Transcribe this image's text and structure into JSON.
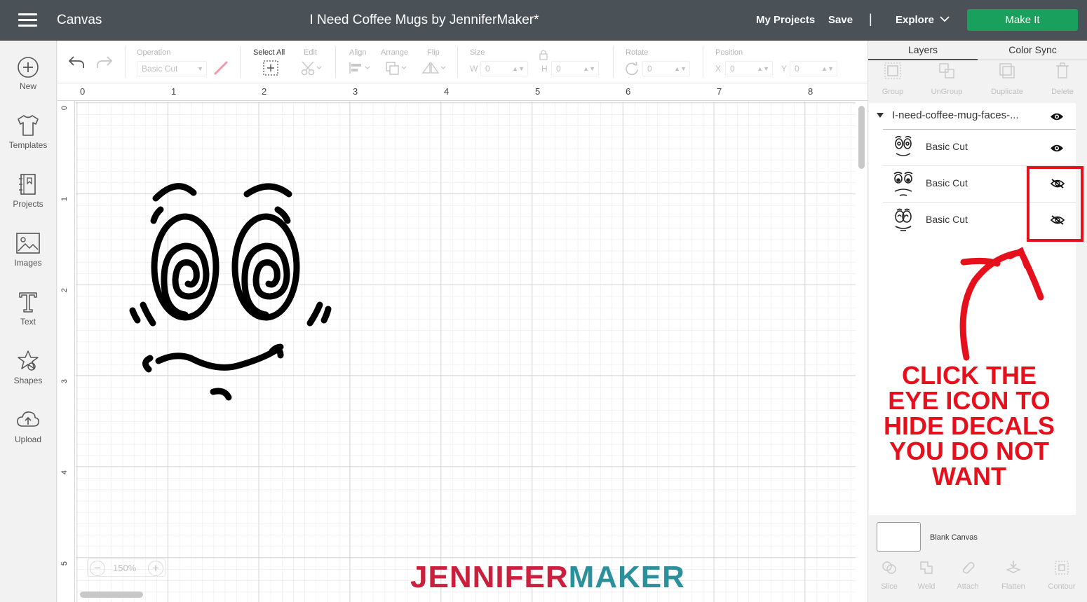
{
  "header": {
    "app_name": "Canvas",
    "doc_title": "I Need Coffee Mugs by JenniferMaker*",
    "my_projects": "My Projects",
    "save": "Save",
    "divider": "|",
    "explore": "Explore",
    "make_it": "Make It"
  },
  "sidebar": {
    "items": [
      {
        "label": "New",
        "icon": "plus-circle-icon"
      },
      {
        "label": "Templates",
        "icon": "shirt-icon"
      },
      {
        "label": "Projects",
        "icon": "projects-icon"
      },
      {
        "label": "Images",
        "icon": "image-icon"
      },
      {
        "label": "Text",
        "icon": "text-icon"
      },
      {
        "label": "Shapes",
        "icon": "shapes-icon"
      },
      {
        "label": "Upload",
        "icon": "upload-cloud-icon"
      }
    ]
  },
  "toolbar": {
    "operation_label": "Operation",
    "operation_value": "Basic Cut",
    "select_all_label": "Select All",
    "edit_label": "Edit",
    "align_label": "Align",
    "arrange_label": "Arrange",
    "flip_label": "Flip",
    "size_label": "Size",
    "w_label": "W",
    "w_value": "0",
    "h_label": "H",
    "h_value": "0",
    "rotate_label": "Rotate",
    "rotate_value": "0",
    "position_label": "Position",
    "x_label": "X",
    "x_value": "0",
    "y_label": "Y",
    "y_value": "0"
  },
  "canvas": {
    "ruler_top": [
      "0",
      "1",
      "2",
      "3",
      "4",
      "5",
      "6",
      "7",
      "8"
    ],
    "ruler_left": [
      "0",
      "1",
      "2",
      "3",
      "4",
      "5"
    ],
    "zoom_level": "150%",
    "zoom_minus": "−",
    "zoom_plus": "+",
    "watermark_a": "JENNIFER",
    "watermark_b": "MAKER"
  },
  "panel": {
    "tabs": [
      "Layers",
      "Color Sync"
    ],
    "actions": [
      "Group",
      "UnGroup",
      "Duplicate",
      "Delete"
    ],
    "group_name": "I-need-coffee-mug-faces-...",
    "layers": [
      {
        "name": "Basic Cut",
        "visible": true
      },
      {
        "name": "Basic Cut",
        "visible": false
      },
      {
        "name": "Basic Cut",
        "visible": false
      }
    ],
    "callout": [
      "CLICK THE",
      "EYE ICON TO",
      "HIDE DECALS",
      "YOU DO NOT",
      "WANT"
    ],
    "blank_canvas": "Blank Canvas",
    "bottom_actions": [
      "Slice",
      "Weld",
      "Attach",
      "Flatten",
      "Contour"
    ]
  },
  "colors": {
    "header_bg": "#4a5157",
    "make_it": "#19a05c",
    "annotation_red": "#e5101b",
    "brand_red": "#c9203d",
    "brand_teal": "#2b8f9c"
  }
}
